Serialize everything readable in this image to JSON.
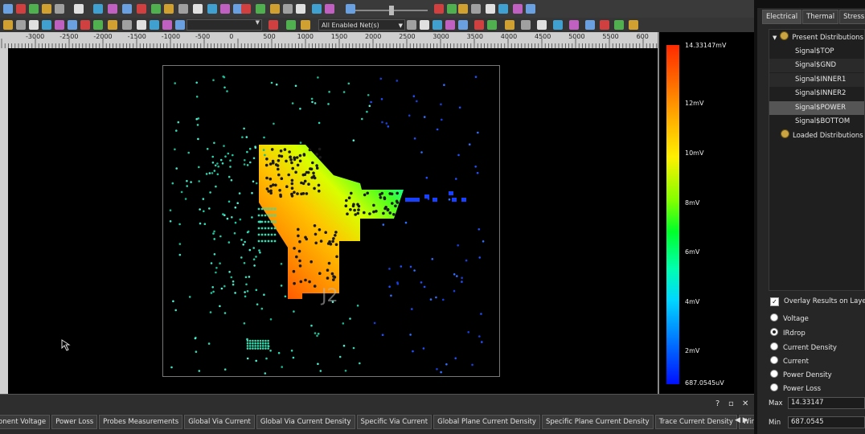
{
  "toolbar": {
    "net_filter": "All Enabled Net(s)"
  },
  "ruler": {
    "labels": [
      "-3000",
      "-2500",
      "-2000",
      "-1500",
      "-1000",
      "-500",
      "0",
      "500",
      "1000",
      "1500",
      "2000",
      "2500",
      "3000",
      "3500",
      "4000",
      "4500",
      "5000",
      "5500",
      "600"
    ]
  },
  "canvas": {
    "board_label": "J2"
  },
  "color_scale": {
    "labels": [
      "14.33147mV",
      "12mV",
      "10mV",
      "8mV",
      "6mV",
      "4mV",
      "2mV",
      "687.0545uV"
    ]
  },
  "bottom_panel": {
    "header_buttons": [
      "?",
      "▫",
      "✕"
    ],
    "tabs": [
      "onent Voltage",
      "Power Loss",
      "Probes Measurements",
      "Global Via Current",
      "Global Via Current Density",
      "Specific Via Current",
      "Global Plane Current Density",
      "Specific Plane Current Density",
      "Trace Current Density",
      "Wirebond Current"
    ],
    "tab_arrows": "◀ ▶"
  },
  "right_panel": {
    "tabs": [
      "Electrical",
      "Thermal",
      "Stress"
    ],
    "active_tab": "Electrical",
    "tree": {
      "present_label": "Present Distributions",
      "items": [
        "Signal$TOP",
        "Signal$GND",
        "Signal$INNER1",
        "Signal$INNER2",
        "Signal$POWER",
        "Signal$BOTTOM"
      ],
      "selected": "Signal$POWER",
      "loaded_label": "Loaded Distributions"
    },
    "overlay_label": "Overlay Results on Layer V",
    "overlay_checked": true,
    "results": [
      "Voltage",
      "IRdrop",
      "Current Density",
      "Current",
      "Power Density",
      "Power Loss"
    ],
    "selected_result": "IRdrop",
    "max_label": "Max",
    "max_value": "14.33147",
    "min_label": "Min",
    "min_value": "687.0545"
  }
}
